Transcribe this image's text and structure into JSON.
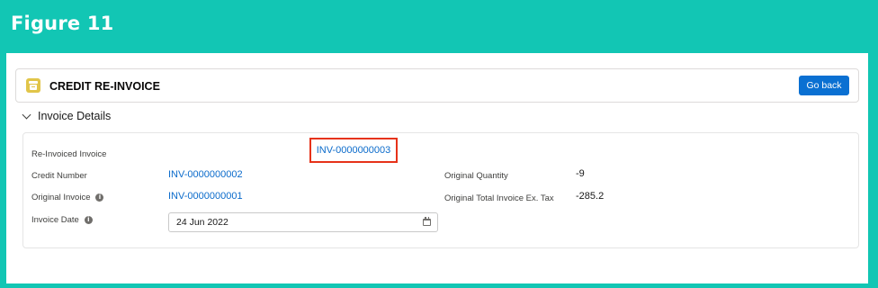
{
  "figure": {
    "title": "Figure 11"
  },
  "header": {
    "title": "CREDIT RE-INVOICE",
    "icon": "record-box-icon",
    "go_back_label": "Go back"
  },
  "section": {
    "label": "Invoice Details",
    "expanded": true
  },
  "fields": {
    "reinvoiced_invoice": {
      "label": "Re-Invoiced Invoice",
      "value": "INV-0000000003"
    },
    "credit_number": {
      "label": "Credit Number",
      "value": "INV-0000000002"
    },
    "original_invoice": {
      "label": "Original Invoice",
      "value": "INV-0000000001",
      "info_icon": "i"
    },
    "invoice_date": {
      "label": "Invoice Date",
      "value": "24 Jun 2022",
      "info_icon": "i"
    },
    "original_quantity": {
      "label": "Original Quantity",
      "value": "-9"
    },
    "original_total": {
      "label": "Original Total Invoice Ex. Tax",
      "value": "-285.2"
    }
  },
  "colors": {
    "frame": "#12c6b4",
    "brand_button": "#0a70d2",
    "link": "#0b6bcb",
    "highlight": "#e63219",
    "header_icon": "#e1c549"
  }
}
